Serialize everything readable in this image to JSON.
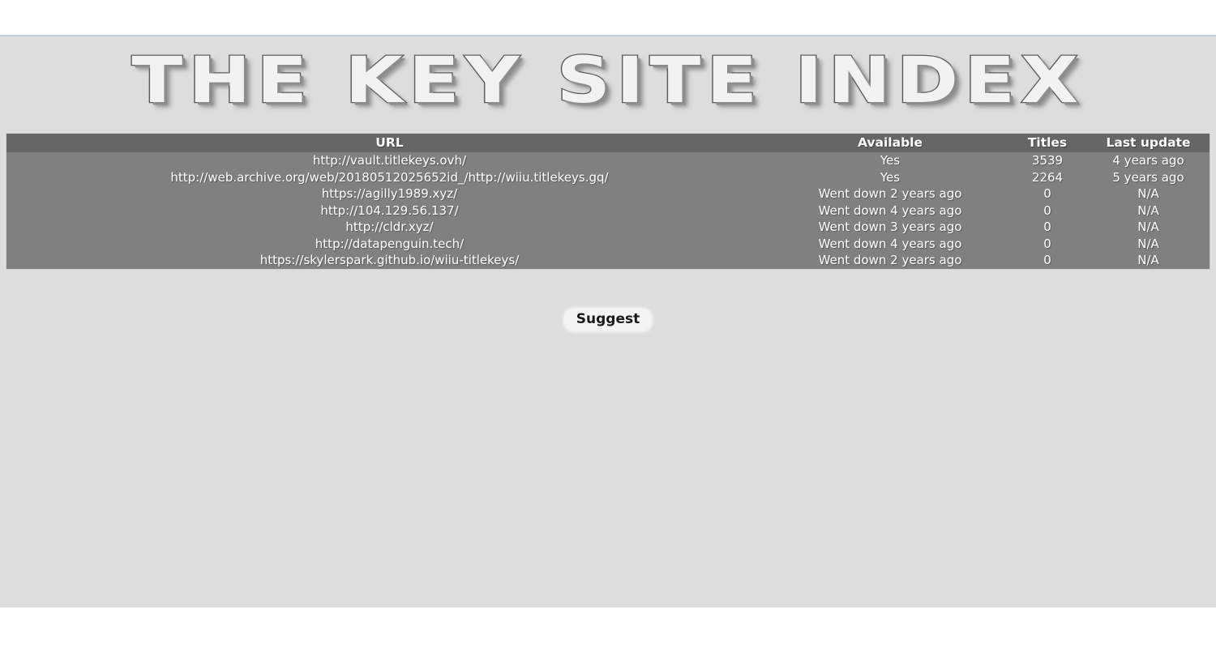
{
  "browser": {
    "chrome_visible": true
  },
  "page": {
    "title": "THE KEY SITE INDEX",
    "background_color": "#dddddd"
  },
  "table": {
    "header_color": "#666666",
    "row_color": "#808080",
    "text_color": "#ffffff",
    "columns": [
      {
        "key": "url",
        "label": "URL"
      },
      {
        "key": "available",
        "label": "Available"
      },
      {
        "key": "titles",
        "label": "Titles"
      },
      {
        "key": "last_update",
        "label": "Last update"
      }
    ],
    "rows": [
      {
        "url": "http://vault.titlekeys.ovh/",
        "available": "Yes",
        "titles": "3539",
        "last_update": "4 years ago"
      },
      {
        "url": "http://web.archive.org/web/20180512025652id_/http://wiiu.titlekeys.gq/",
        "available": "Yes",
        "titles": "2264",
        "last_update": "5 years ago"
      },
      {
        "url": "https://agilly1989.xyz/",
        "available": "Went down 2 years ago",
        "titles": "0",
        "last_update": "N/A"
      },
      {
        "url": "http://104.129.56.137/",
        "available": "Went down 4 years ago",
        "titles": "0",
        "last_update": "N/A"
      },
      {
        "url": "http://cldr.xyz/",
        "available": "Went down 3 years ago",
        "titles": "0",
        "last_update": "N/A"
      },
      {
        "url": "http://datapenguin.tech/",
        "available": "Went down 4 years ago",
        "titles": "0",
        "last_update": "N/A"
      },
      {
        "url": "https://skylerspark.github.io/wiiu-titlekeys/",
        "available": "Went down 2 years ago",
        "titles": "0",
        "last_update": "N/A"
      }
    ]
  },
  "actions": {
    "suggest_label": "Suggest"
  }
}
